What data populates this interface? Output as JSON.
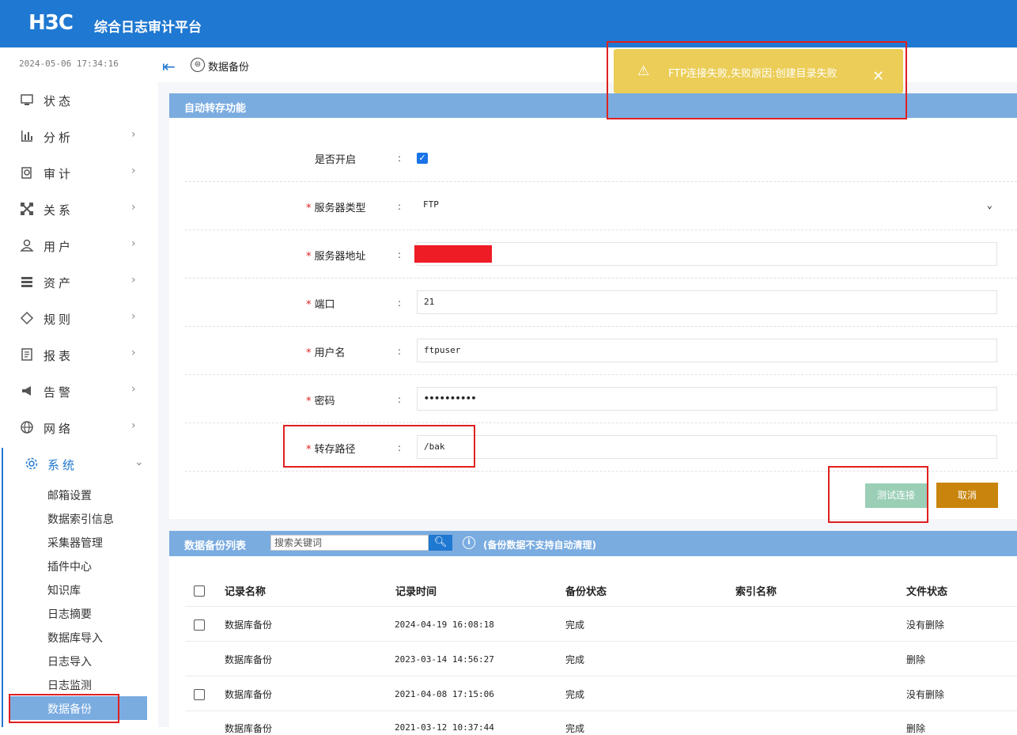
{
  "header": {
    "logo": "H3C",
    "app_title": "综合日志审计平台"
  },
  "sidebar": {
    "datetime": "2024-05-06 17:34:16",
    "items": [
      {
        "label": "状态",
        "icon": "monitor-icon"
      },
      {
        "label": "分析",
        "icon": "bar-chart-icon"
      },
      {
        "label": "审计",
        "icon": "audit-icon"
      },
      {
        "label": "关系",
        "icon": "network-relation-icon"
      },
      {
        "label": "用户",
        "icon": "user-icon"
      },
      {
        "label": "资产",
        "icon": "server-icon"
      },
      {
        "label": "规则",
        "icon": "diamond-icon"
      },
      {
        "label": "报表",
        "icon": "report-icon"
      },
      {
        "label": "告警",
        "icon": "megaphone-icon"
      },
      {
        "label": "网络",
        "icon": "globe-icon"
      },
      {
        "label": "系统",
        "icon": "gear-icon"
      }
    ],
    "sub_items": [
      "邮箱设置",
      "数据索引信息",
      "采集器管理",
      "插件中心",
      "知识库",
      "日志摘要",
      "数据库导入",
      "日志导入",
      "日志监测",
      "数据备份"
    ],
    "active_sub": "数据备份"
  },
  "breadcrumb": {
    "page": "数据备份"
  },
  "toast": {
    "message": "FTP连接失败,失败原因:创建目录失败"
  },
  "form": {
    "title": "自动转存功能",
    "enabled_label": "是否开启",
    "server_type_label": "服务器类型",
    "server_type_value": "FTP",
    "server_addr_label": "服务器地址",
    "port_label": "端口",
    "port_value": "21",
    "username_label": "用户名",
    "username_value": "ftpuser",
    "password_label": "密码",
    "password_value": "••••••••••",
    "path_label": "转存路径",
    "path_value": "/bak",
    "colon": ":",
    "required_mark": "*",
    "test_button": "测试连接",
    "cancel_button": "取消"
  },
  "list": {
    "title": "数据备份列表",
    "search_placeholder": "搜索关键词",
    "note": "(备份数据不支持自动清理)",
    "columns": [
      "记录名称",
      "记录时间",
      "备份状态",
      "索引名称",
      "文件状态"
    ],
    "rows": [
      {
        "name": "数据库备份",
        "time": "2024-04-19 16:08:18",
        "status": "完成",
        "index": "",
        "file_status": "没有删除",
        "checkbox": true
      },
      {
        "name": "数据库备份",
        "time": "2023-03-14 14:56:27",
        "status": "完成",
        "index": "",
        "file_status": "删除",
        "checkbox": false
      },
      {
        "name": "数据库备份",
        "time": "2021-04-08 17:15:06",
        "status": "完成",
        "index": "",
        "file_status": "没有删除",
        "checkbox": true
      },
      {
        "name": "数据库备份",
        "time": "2021-03-12 10:37:44",
        "status": "完成",
        "index": "",
        "file_status": "删除",
        "checkbox": false
      }
    ]
  }
}
